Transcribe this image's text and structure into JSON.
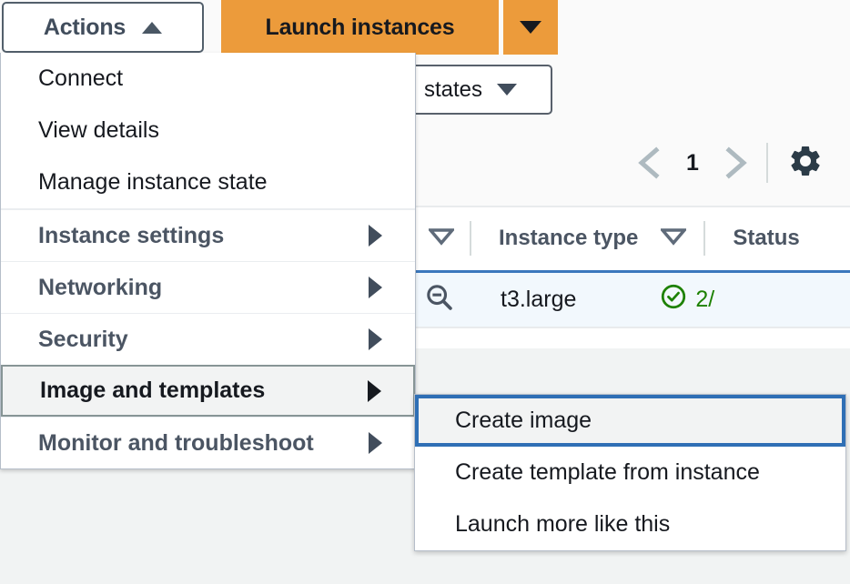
{
  "toolbar": {
    "actions_button": {
      "label": "Actions",
      "icon": "triangle-up-icon"
    },
    "launch_button": {
      "label": "Launch instances"
    },
    "launch_caret": {
      "icon": "triangle-down-icon"
    }
  },
  "filters": {
    "states_dropdown": {
      "label": "states",
      "icon": "triangle-down-icon"
    }
  },
  "pagination": {
    "prev_icon": "chevron-left-icon",
    "page": "1",
    "next_icon": "chevron-right-icon",
    "settings_icon": "gear-icon"
  },
  "table": {
    "columns": [
      {
        "label": "Instance type",
        "sort_icon": "sort-caret-icon"
      },
      {
        "label": "Status",
        "sort_icon": "sort-caret-icon"
      }
    ],
    "leading_sort_icon": "sort-caret-icon",
    "rows": [
      {
        "expand_icon": "zoom-out-icon",
        "instance_type": "t3.large",
        "status_icon": "status-check-icon",
        "status": "2/"
      }
    ]
  },
  "actions_menu": {
    "items": [
      {
        "label": "Connect",
        "type": "item"
      },
      {
        "label": "View details",
        "type": "item"
      },
      {
        "label": "Manage instance state",
        "type": "item"
      },
      {
        "label": "Instance settings",
        "type": "group",
        "icon": "arrow-right-icon"
      },
      {
        "label": "Networking",
        "type": "group",
        "icon": "arrow-right-icon"
      },
      {
        "label": "Security",
        "type": "group",
        "icon": "arrow-right-icon"
      },
      {
        "label": "Image and templates",
        "type": "group",
        "icon": "arrow-right-icon",
        "selected": true
      },
      {
        "label": "Monitor and troubleshoot",
        "type": "group",
        "icon": "arrow-right-icon"
      }
    ]
  },
  "submenu": {
    "items": [
      {
        "label": "Create image",
        "focused": true
      },
      {
        "label": "Create template from instance",
        "focused": false
      },
      {
        "label": "Launch more like this",
        "focused": false
      }
    ]
  },
  "colors": {
    "accent_orange": "#ec9b3b",
    "focus_blue": "#2f6fb5",
    "row_select_blue": "#3b77bd",
    "status_green": "#1d8102",
    "text_dark": "#16191f",
    "text_muted": "#4b5563"
  }
}
